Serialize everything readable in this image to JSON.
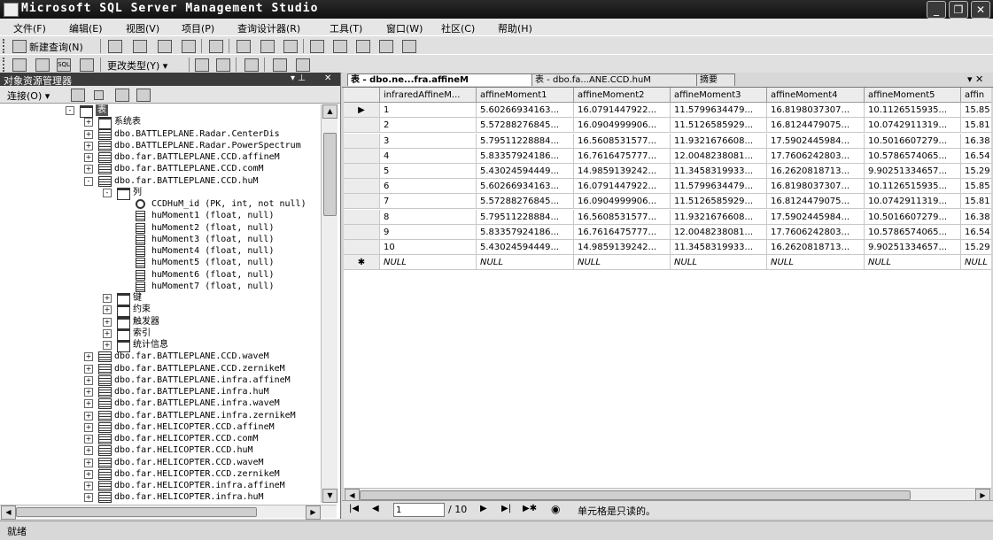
{
  "window": {
    "title": "Microsoft SQL Server Management Studio",
    "minimize": "_",
    "restore": "❐",
    "close": "✕"
  },
  "menu": [
    "文件(F)",
    "编辑(E)",
    "视图(V)",
    "项目(P)",
    "查询设计器(R)",
    "工具(T)",
    "窗口(W)",
    "社区(C)",
    "帮助(H)"
  ],
  "toolbar1": {
    "new_query": "新建查询(N)"
  },
  "toolbar2": {
    "change_type": "更改类型(Y) ▾",
    "sql_label": "SQL"
  },
  "explorer": {
    "title": "对象资源管理器",
    "pin": "▾ ⊥",
    "close": "✕",
    "connect": "连接(O) ▾",
    "tree": [
      {
        "depth": 0,
        "pm": "-",
        "icon": "folder",
        "label": "表",
        "name": "tree-folder-tables",
        "sel": true
      },
      {
        "depth": 1,
        "pm": "+",
        "icon": "folder",
        "label": "系统表",
        "name": "tree-folder-system-tables"
      },
      {
        "depth": 1,
        "pm": "+",
        "icon": "table",
        "label": "dbo.BATTLEPLANE.Radar.CenterDis",
        "name": "tree-table"
      },
      {
        "depth": 1,
        "pm": "+",
        "icon": "table",
        "label": "dbo.BATTLEPLANE.Radar.PowerSpectrum",
        "name": "tree-table"
      },
      {
        "depth": 1,
        "pm": "+",
        "icon": "table",
        "label": "dbo.far.BATTLEPLANE.CCD.affineM",
        "name": "tree-table"
      },
      {
        "depth": 1,
        "pm": "+",
        "icon": "table",
        "label": "dbo.far.BATTLEPLANE.CCD.comM",
        "name": "tree-table"
      },
      {
        "depth": 1,
        "pm": "-",
        "icon": "table",
        "label": "dbo.far.BATTLEPLANE.CCD.huM",
        "name": "tree-table-expanded"
      },
      {
        "depth": 2,
        "pm": "-",
        "icon": "folder",
        "label": "列",
        "name": "tree-folder-columns"
      },
      {
        "depth": 3,
        "pm": "",
        "icon": "key",
        "label": "CCDHuM_id (PK, int, not null)",
        "name": "tree-column-pk"
      },
      {
        "depth": 3,
        "pm": "",
        "icon": "col",
        "label": "huMoment1 (float, null)",
        "name": "tree-column"
      },
      {
        "depth": 3,
        "pm": "",
        "icon": "col",
        "label": "huMoment2 (float, null)",
        "name": "tree-column"
      },
      {
        "depth": 3,
        "pm": "",
        "icon": "col",
        "label": "huMoment3 (float, null)",
        "name": "tree-column"
      },
      {
        "depth": 3,
        "pm": "",
        "icon": "col",
        "label": "huMoment4 (float, null)",
        "name": "tree-column"
      },
      {
        "depth": 3,
        "pm": "",
        "icon": "col",
        "label": "huMoment5 (float, null)",
        "name": "tree-column"
      },
      {
        "depth": 3,
        "pm": "",
        "icon": "col",
        "label": "huMoment6 (float, null)",
        "name": "tree-column"
      },
      {
        "depth": 3,
        "pm": "",
        "icon": "col",
        "label": "huMoment7 (float, null)",
        "name": "tree-column"
      },
      {
        "depth": 2,
        "pm": "+",
        "icon": "folder",
        "label": "键",
        "name": "tree-folder-keys"
      },
      {
        "depth": 2,
        "pm": "+",
        "icon": "folder",
        "label": "约束",
        "name": "tree-folder-constraints"
      },
      {
        "depth": 2,
        "pm": "+",
        "icon": "folder",
        "label": "触发器",
        "name": "tree-folder-triggers"
      },
      {
        "depth": 2,
        "pm": "+",
        "icon": "folder",
        "label": "索引",
        "name": "tree-folder-indexes"
      },
      {
        "depth": 2,
        "pm": "+",
        "icon": "folder",
        "label": "统计信息",
        "name": "tree-folder-statistics"
      },
      {
        "depth": 1,
        "pm": "+",
        "icon": "table",
        "label": "dbo.far.BATTLEPLANE.CCD.waveM",
        "name": "tree-table"
      },
      {
        "depth": 1,
        "pm": "+",
        "icon": "table",
        "label": "dbo.far.BATTLEPLANE.CCD.zernikeM",
        "name": "tree-table"
      },
      {
        "depth": 1,
        "pm": "+",
        "icon": "table",
        "label": "dbo.far.BATTLEPLANE.infra.affineM",
        "name": "tree-table"
      },
      {
        "depth": 1,
        "pm": "+",
        "icon": "table",
        "label": "dbo.far.BATTLEPLANE.infra.huM",
        "name": "tree-table"
      },
      {
        "depth": 1,
        "pm": "+",
        "icon": "table",
        "label": "dbo.far.BATTLEPLANE.infra.waveM",
        "name": "tree-table"
      },
      {
        "depth": 1,
        "pm": "+",
        "icon": "table",
        "label": "dbo.far.BATTLEPLANE.infra.zernikeM",
        "name": "tree-table"
      },
      {
        "depth": 1,
        "pm": "+",
        "icon": "table",
        "label": "dbo.far.HELICOPTER.CCD.affineM",
        "name": "tree-table"
      },
      {
        "depth": 1,
        "pm": "+",
        "icon": "table",
        "label": "dbo.far.HELICOPTER.CCD.comM",
        "name": "tree-table"
      },
      {
        "depth": 1,
        "pm": "+",
        "icon": "table",
        "label": "dbo.far.HELICOPTER.CCD.huM",
        "name": "tree-table"
      },
      {
        "depth": 1,
        "pm": "+",
        "icon": "table",
        "label": "dbo.far.HELICOPTER.CCD.waveM",
        "name": "tree-table"
      },
      {
        "depth": 1,
        "pm": "+",
        "icon": "table",
        "label": "dbo.far.HELICOPTER.CCD.zernikeM",
        "name": "tree-table"
      },
      {
        "depth": 1,
        "pm": "+",
        "icon": "table",
        "label": "dbo.far.HELICOPTER.infra.affineM",
        "name": "tree-table"
      },
      {
        "depth": 1,
        "pm": "+",
        "icon": "table",
        "label": "dbo.far.HELICOPTER.infra.huM",
        "name": "tree-table"
      }
    ]
  },
  "tabs": [
    {
      "label": "表 - dbo.ne...fra.affineM",
      "active": true
    },
    {
      "label": "表 - dbo.fa...ANE.CCD.huM",
      "active": false
    },
    {
      "label": "摘要",
      "active": false
    }
  ],
  "tab_controls": "▾ ✕",
  "grid": {
    "columns": [
      "infraredAffineM...",
      "affineMoment1",
      "affineMoment2",
      "affineMoment3",
      "affineMoment4",
      "affineMoment5",
      "affin"
    ],
    "rows": [
      [
        "1",
        "5.60266934163...",
        "16.0791447922...",
        "11.5799634479...",
        "16.8198037307...",
        "10.1126515935...",
        "15.85"
      ],
      [
        "2",
        "5.57288276845...",
        "16.0904999906...",
        "11.5126585929...",
        "16.8124479075...",
        "10.0742911319...",
        "15.81"
      ],
      [
        "3",
        "5.79511228884...",
        "16.5608531577...",
        "11.9321676608...",
        "17.5902445984...",
        "10.5016607279...",
        "16.38"
      ],
      [
        "4",
        "5.83357924186...",
        "16.7616475777...",
        "12.0048238081...",
        "17.7606242803...",
        "10.5786574065...",
        "16.54"
      ],
      [
        "5",
        "5.43024594449...",
        "14.9859139242...",
        "11.3458319933...",
        "16.2620818713...",
        "9.90251334657...",
        "15.29"
      ],
      [
        "6",
        "5.60266934163...",
        "16.0791447922...",
        "11.5799634479...",
        "16.8198037307...",
        "10.1126515935...",
        "15.85"
      ],
      [
        "7",
        "5.57288276845...",
        "16.0904999906...",
        "11.5126585929...",
        "16.8124479075...",
        "10.0742911319...",
        "15.81"
      ],
      [
        "8",
        "5.79511228884...",
        "16.5608531577...",
        "11.9321676608...",
        "17.5902445984...",
        "10.5016607279...",
        "16.38"
      ],
      [
        "9",
        "5.83357924186...",
        "16.7616475777...",
        "12.0048238081...",
        "17.7606242803...",
        "10.5786574065...",
        "16.54"
      ],
      [
        "10",
        "5.43024594449...",
        "14.9859139242...",
        "11.3458319933...",
        "16.2620818713...",
        "9.90251334657...",
        "15.29"
      ]
    ],
    "null_text": "NULL",
    "current_marker": "▶",
    "new_marker": "✱"
  },
  "nav": {
    "first": "|◀",
    "prev": "◀",
    "current": "1",
    "total": "/ 10",
    "next": "▶",
    "last": "▶|",
    "new": "▶✱",
    "stop": "◉",
    "message": "单元格是只读的。"
  },
  "status": {
    "text": "就绪"
  }
}
